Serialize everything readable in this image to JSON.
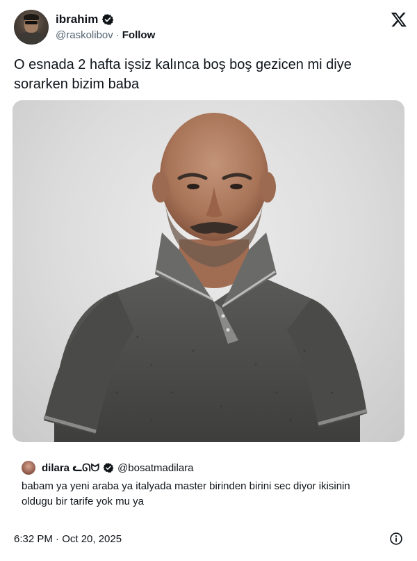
{
  "author": {
    "display_name": "ibrahim",
    "handle": "@raskolibov",
    "separator": "·",
    "follow_label": "Follow"
  },
  "tweet": {
    "text": "O esnada 2 hafta işsiz kalınca boş boş gezicen mi diye sorarken bizim baba"
  },
  "quote": {
    "display_name": "dilara ᓚᘏᗢ",
    "handle": "@bosatmadilara",
    "text": "babam ya yeni araba ya italyada master birinden birini sec diyor ikisinin oldugu bir tarife yok mu ya"
  },
  "footer": {
    "timestamp": "6:32 PM · Oct 20, 2025"
  },
  "colors": {
    "text": "#0f1419",
    "secondary": "#536471",
    "verified_badge": "#0f1419"
  },
  "icons": [
    "verified-badge-icon",
    "x-logo-icon",
    "info-icon"
  ]
}
